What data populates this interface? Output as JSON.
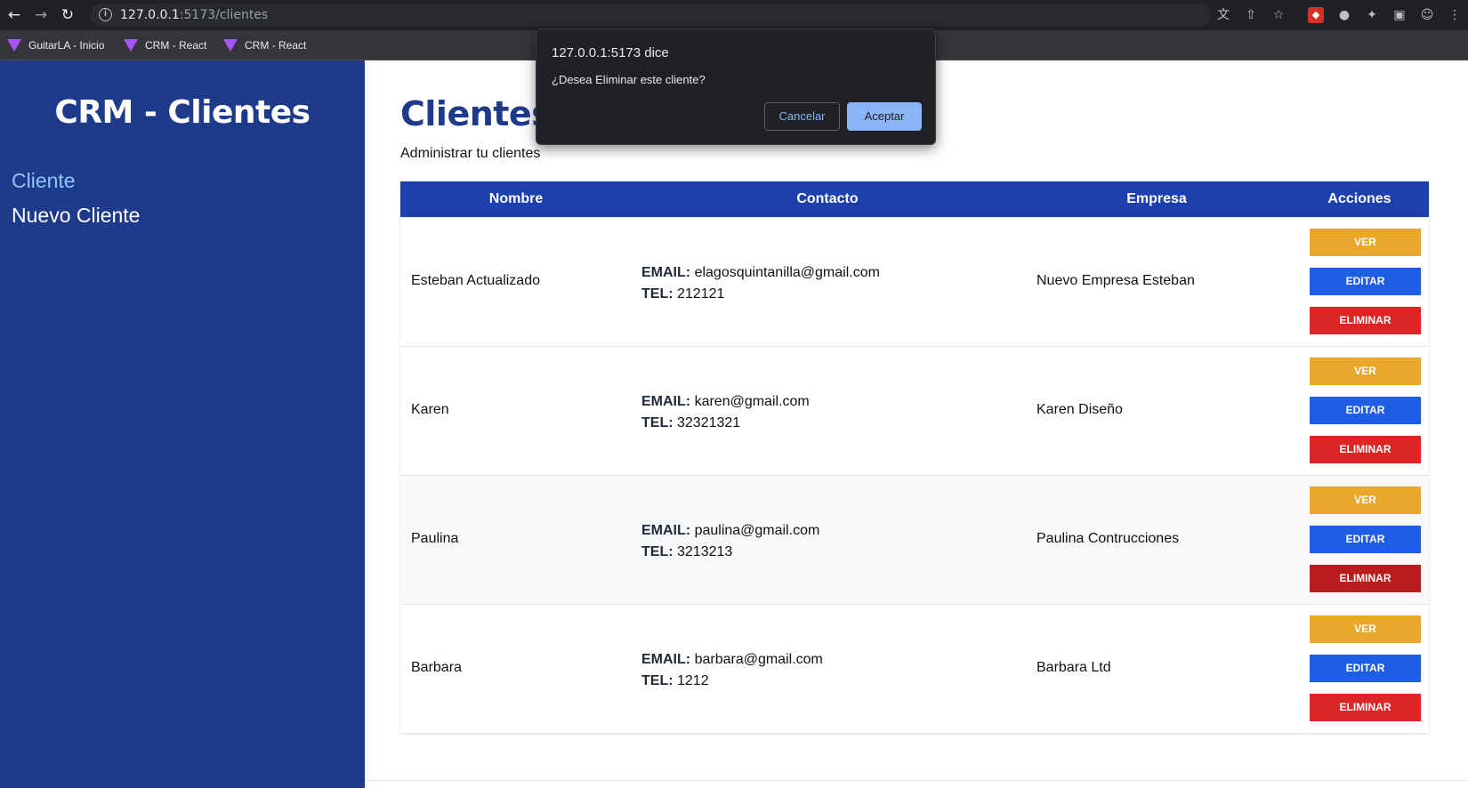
{
  "browser": {
    "url_host": "127.0.0.1",
    "url_path": ":5173/clientes",
    "bookmarks": [
      "GuitarLA - Inicio",
      "CRM - React",
      "CRM - React"
    ]
  },
  "sidebar": {
    "title": "CRM - Clientes",
    "links": [
      "Cliente",
      "Nuevo Cliente"
    ]
  },
  "main": {
    "title": "Clientes",
    "subtitle": "Administrar tu clientes"
  },
  "table": {
    "headers": [
      "Nombre",
      "Contacto",
      "Empresa",
      "Acciones"
    ],
    "email_label": "EMAIL:",
    "tel_label": "TEL:",
    "rows": [
      {
        "name": "Esteban Actualizado",
        "email": "elagosquintanilla@gmail.com",
        "tel": "212121",
        "company": "Nuevo Empresa Esteban"
      },
      {
        "name": "Karen",
        "email": "karen@gmail.com",
        "tel": "32321321",
        "company": "Karen Diseño"
      },
      {
        "name": "Paulina",
        "email": "paulina@gmail.com",
        "tel": "3213213",
        "company": "Paulina Contrucciones"
      },
      {
        "name": "Barbara",
        "email": "barbara@gmail.com",
        "tel": "1212",
        "company": "Barbara Ltd"
      }
    ],
    "actions": {
      "view": "VER",
      "edit": "EDITAR",
      "delete": "ELIMINAR"
    }
  },
  "dialog": {
    "title": "127.0.0.1:5173 dice",
    "message": "¿Desea Eliminar este cliente?",
    "cancel": "Cancelar",
    "accept": "Aceptar"
  },
  "colors": {
    "sidebar_bg": "#1e3a8a",
    "table_header_bg": "#1e40af",
    "ver_btn": "#e9a82b",
    "editar_btn": "#1d5ee5",
    "eliminar_btn": "#dc2626"
  }
}
